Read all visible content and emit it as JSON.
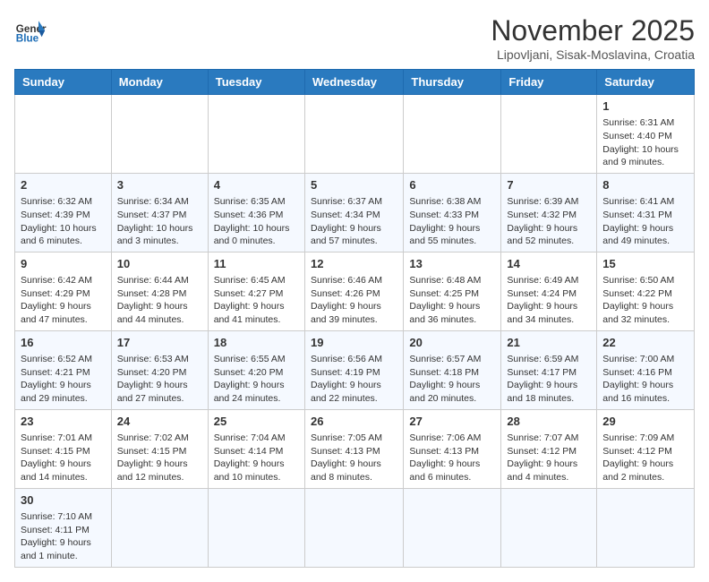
{
  "header": {
    "logo_general": "General",
    "logo_blue": "Blue",
    "month_title": "November 2025",
    "location": "Lipovljani, Sisak-Moslavina, Croatia"
  },
  "days_of_week": [
    "Sunday",
    "Monday",
    "Tuesday",
    "Wednesday",
    "Thursday",
    "Friday",
    "Saturday"
  ],
  "weeks": [
    [
      {
        "day": "",
        "info": ""
      },
      {
        "day": "",
        "info": ""
      },
      {
        "day": "",
        "info": ""
      },
      {
        "day": "",
        "info": ""
      },
      {
        "day": "",
        "info": ""
      },
      {
        "day": "",
        "info": ""
      },
      {
        "day": "1",
        "info": "Sunrise: 6:31 AM\nSunset: 4:40 PM\nDaylight: 10 hours and 9 minutes."
      }
    ],
    [
      {
        "day": "2",
        "info": "Sunrise: 6:32 AM\nSunset: 4:39 PM\nDaylight: 10 hours and 6 minutes."
      },
      {
        "day": "3",
        "info": "Sunrise: 6:34 AM\nSunset: 4:37 PM\nDaylight: 10 hours and 3 minutes."
      },
      {
        "day": "4",
        "info": "Sunrise: 6:35 AM\nSunset: 4:36 PM\nDaylight: 10 hours and 0 minutes."
      },
      {
        "day": "5",
        "info": "Sunrise: 6:37 AM\nSunset: 4:34 PM\nDaylight: 9 hours and 57 minutes."
      },
      {
        "day": "6",
        "info": "Sunrise: 6:38 AM\nSunset: 4:33 PM\nDaylight: 9 hours and 55 minutes."
      },
      {
        "day": "7",
        "info": "Sunrise: 6:39 AM\nSunset: 4:32 PM\nDaylight: 9 hours and 52 minutes."
      },
      {
        "day": "8",
        "info": "Sunrise: 6:41 AM\nSunset: 4:31 PM\nDaylight: 9 hours and 49 minutes."
      }
    ],
    [
      {
        "day": "9",
        "info": "Sunrise: 6:42 AM\nSunset: 4:29 PM\nDaylight: 9 hours and 47 minutes."
      },
      {
        "day": "10",
        "info": "Sunrise: 6:44 AM\nSunset: 4:28 PM\nDaylight: 9 hours and 44 minutes."
      },
      {
        "day": "11",
        "info": "Sunrise: 6:45 AM\nSunset: 4:27 PM\nDaylight: 9 hours and 41 minutes."
      },
      {
        "day": "12",
        "info": "Sunrise: 6:46 AM\nSunset: 4:26 PM\nDaylight: 9 hours and 39 minutes."
      },
      {
        "day": "13",
        "info": "Sunrise: 6:48 AM\nSunset: 4:25 PM\nDaylight: 9 hours and 36 minutes."
      },
      {
        "day": "14",
        "info": "Sunrise: 6:49 AM\nSunset: 4:24 PM\nDaylight: 9 hours and 34 minutes."
      },
      {
        "day": "15",
        "info": "Sunrise: 6:50 AM\nSunset: 4:22 PM\nDaylight: 9 hours and 32 minutes."
      }
    ],
    [
      {
        "day": "16",
        "info": "Sunrise: 6:52 AM\nSunset: 4:21 PM\nDaylight: 9 hours and 29 minutes."
      },
      {
        "day": "17",
        "info": "Sunrise: 6:53 AM\nSunset: 4:20 PM\nDaylight: 9 hours and 27 minutes."
      },
      {
        "day": "18",
        "info": "Sunrise: 6:55 AM\nSunset: 4:20 PM\nDaylight: 9 hours and 24 minutes."
      },
      {
        "day": "19",
        "info": "Sunrise: 6:56 AM\nSunset: 4:19 PM\nDaylight: 9 hours and 22 minutes."
      },
      {
        "day": "20",
        "info": "Sunrise: 6:57 AM\nSunset: 4:18 PM\nDaylight: 9 hours and 20 minutes."
      },
      {
        "day": "21",
        "info": "Sunrise: 6:59 AM\nSunset: 4:17 PM\nDaylight: 9 hours and 18 minutes."
      },
      {
        "day": "22",
        "info": "Sunrise: 7:00 AM\nSunset: 4:16 PM\nDaylight: 9 hours and 16 minutes."
      }
    ],
    [
      {
        "day": "23",
        "info": "Sunrise: 7:01 AM\nSunset: 4:15 PM\nDaylight: 9 hours and 14 minutes."
      },
      {
        "day": "24",
        "info": "Sunrise: 7:02 AM\nSunset: 4:15 PM\nDaylight: 9 hours and 12 minutes."
      },
      {
        "day": "25",
        "info": "Sunrise: 7:04 AM\nSunset: 4:14 PM\nDaylight: 9 hours and 10 minutes."
      },
      {
        "day": "26",
        "info": "Sunrise: 7:05 AM\nSunset: 4:13 PM\nDaylight: 9 hours and 8 minutes."
      },
      {
        "day": "27",
        "info": "Sunrise: 7:06 AM\nSunset: 4:13 PM\nDaylight: 9 hours and 6 minutes."
      },
      {
        "day": "28",
        "info": "Sunrise: 7:07 AM\nSunset: 4:12 PM\nDaylight: 9 hours and 4 minutes."
      },
      {
        "day": "29",
        "info": "Sunrise: 7:09 AM\nSunset: 4:12 PM\nDaylight: 9 hours and 2 minutes."
      }
    ],
    [
      {
        "day": "30",
        "info": "Sunrise: 7:10 AM\nSunset: 4:11 PM\nDaylight: 9 hours and 1 minute."
      },
      {
        "day": "",
        "info": ""
      },
      {
        "day": "",
        "info": ""
      },
      {
        "day": "",
        "info": ""
      },
      {
        "day": "",
        "info": ""
      },
      {
        "day": "",
        "info": ""
      },
      {
        "day": "",
        "info": ""
      }
    ]
  ]
}
